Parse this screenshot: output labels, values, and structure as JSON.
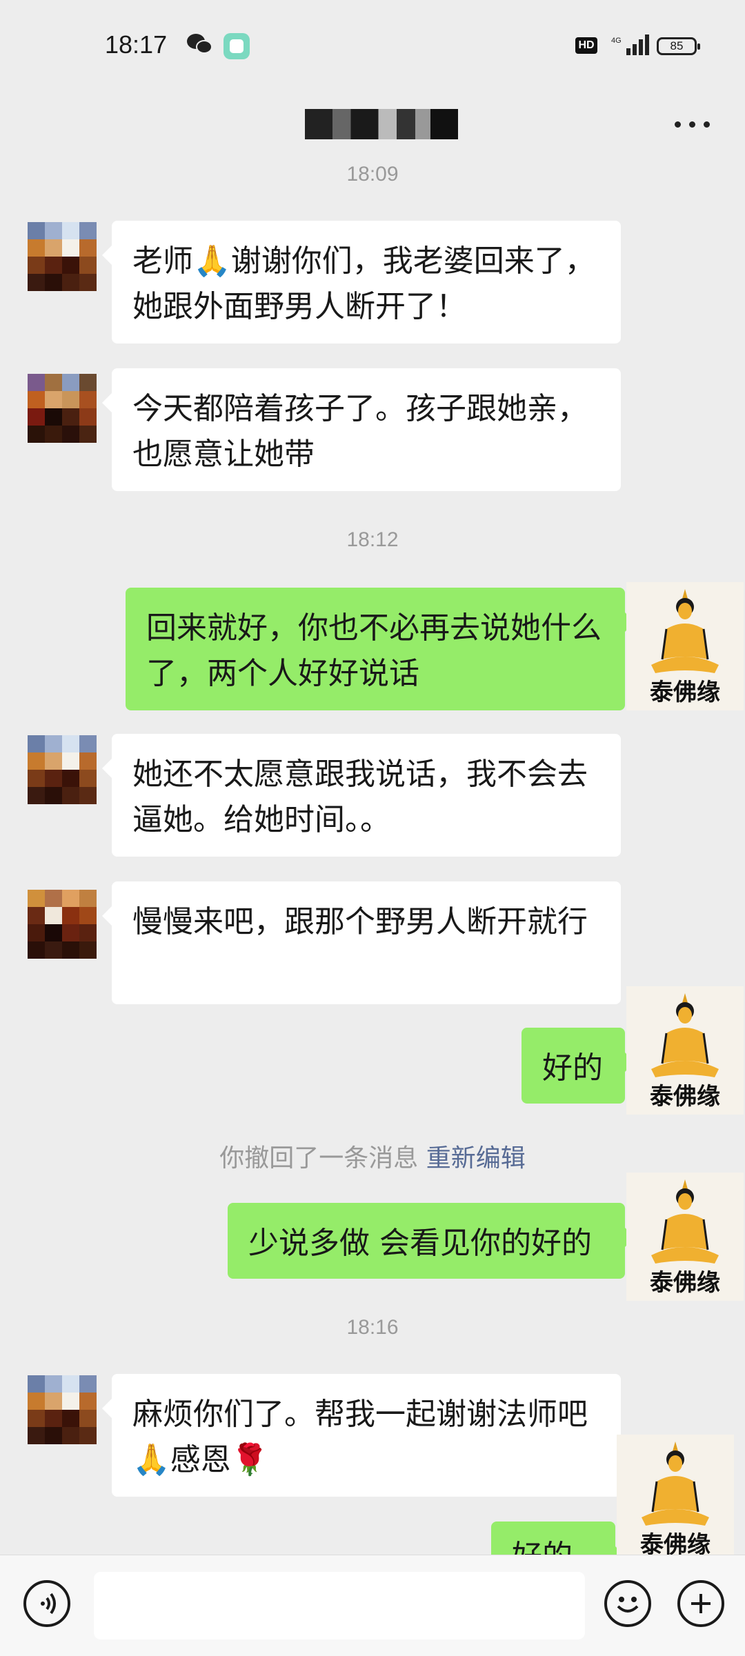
{
  "status_bar": {
    "time": "18:17",
    "network": "4G",
    "battery": "85"
  },
  "chat": {
    "timestamps": [
      "18:09",
      "18:12",
      "18:16"
    ],
    "messages": [
      {
        "side": "in",
        "text": "老师🙏谢谢你们，我老婆回来了，她跟外面野男人断开了！"
      },
      {
        "side": "in",
        "text": "今天都陪着孩子了。孩子跟她亲，也愿意让她带"
      },
      {
        "side": "out",
        "text": "回来就好，你也不必再去说她什么了，两个人好好说话"
      },
      {
        "side": "in",
        "text": "她还不太愿意跟我说话，我不会去逼她。给她时间。。"
      },
      {
        "side": "in",
        "text": "慢慢来吧，跟那个野男人断开就行"
      },
      {
        "side": "out",
        "text": "好的"
      },
      {
        "side": "out",
        "text": "少说多做  会看见你的好的"
      },
      {
        "side": "in",
        "text": "麻烦你们了。帮我一起谢谢法师吧🙏感恩🌹"
      },
      {
        "side": "out",
        "text": "好的👌"
      }
    ],
    "recall_notice": "你撤回了一条消息",
    "recall_edit": "重新编辑",
    "self_avatar_caption": "泰佛缘"
  },
  "colors": {
    "out_bubble": "#95ec69",
    "in_bubble": "#ffffff",
    "background": "#ededed",
    "link": "#576b95"
  },
  "icons": {
    "voice": "voice-icon",
    "emoji": "emoji-icon",
    "plus": "plus-icon",
    "more": "more-icon"
  }
}
